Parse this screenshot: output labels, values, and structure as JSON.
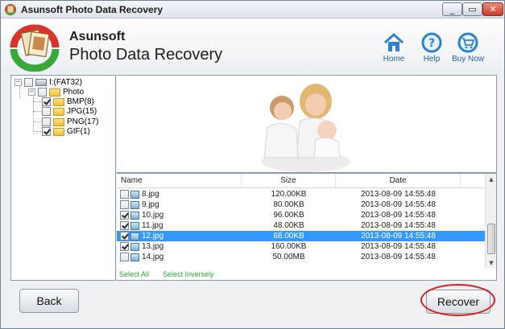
{
  "window": {
    "title": "Asunsoft Photo Data Recovery",
    "controls": {
      "minimize": "▭",
      "maximize": "▭",
      "close": "✕"
    }
  },
  "header": {
    "brand_line1": "Asunsoft",
    "brand_line2": "Photo Data Recovery",
    "buttons": {
      "home": "Home",
      "help": "Help",
      "buy": "Buy Now"
    }
  },
  "tree": {
    "root": {
      "label": "I:(FAT32)",
      "expanded": true,
      "checked": false
    },
    "folder": {
      "label": "Photo",
      "expanded": true,
      "checked": false
    },
    "types": [
      {
        "label": "BMP(8)",
        "checked": true
      },
      {
        "label": "JPG(15)",
        "checked": false
      },
      {
        "label": "PNG(17)",
        "checked": false
      },
      {
        "label": "GIF(1)",
        "checked": true
      }
    ]
  },
  "filelist": {
    "columns": {
      "name": "Name",
      "size": "Size",
      "date": "Date"
    },
    "rows": [
      {
        "name": "8.jpg",
        "size": "120.00KB",
        "date": "2013-08-09 14:55:48",
        "checked": false,
        "selected": false
      },
      {
        "name": "9.jpg",
        "size": "80.00KB",
        "date": "2013-08-09 14:55:48",
        "checked": false,
        "selected": false
      },
      {
        "name": "10.jpg",
        "size": "96.00KB",
        "date": "2013-08-09 14:55:48",
        "checked": true,
        "selected": false
      },
      {
        "name": "11.jpg",
        "size": "48.00KB",
        "date": "2013-08-09 14:55:48",
        "checked": true,
        "selected": false
      },
      {
        "name": "12.jpg",
        "size": "68.00KB",
        "date": "2013-08-09 14:55:48",
        "checked": true,
        "selected": true
      },
      {
        "name": "13.jpg",
        "size": "160.00KB",
        "date": "2013-08-09 14:55:48",
        "checked": true,
        "selected": false
      },
      {
        "name": "14.jpg",
        "size": "50.00MB",
        "date": "2013-08-09 14:55:48",
        "checked": false,
        "selected": false
      }
    ],
    "select_all": "Select All",
    "select_inversely": "Select Inversely"
  },
  "footer": {
    "back_label": "Back",
    "recover_label": "Recover"
  },
  "colors": {
    "selection": "#3399ff",
    "link_green": "#2ea52e",
    "highlight_ring": "#e01b1b",
    "header_icon_blue": "#2f80d1"
  }
}
